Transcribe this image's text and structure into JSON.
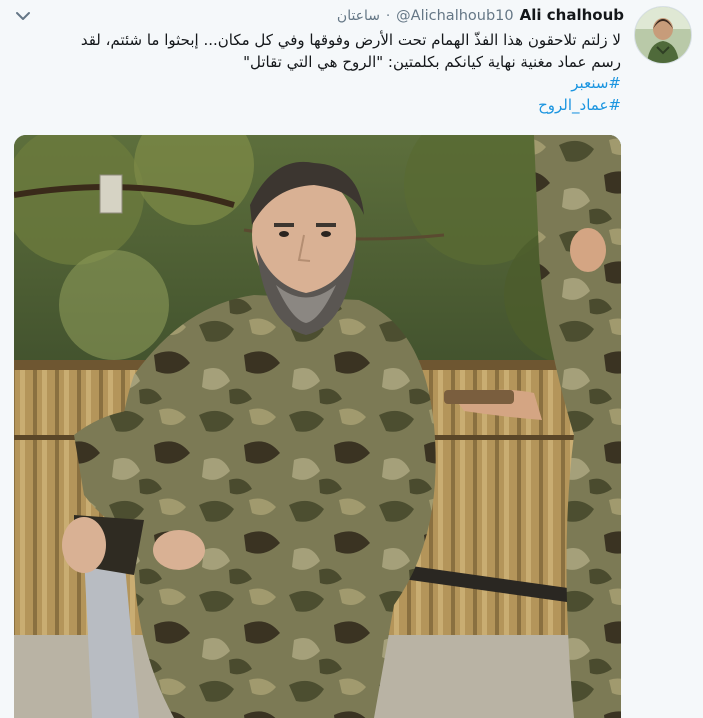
{
  "tweet": {
    "author_name": "Ali chalhoub",
    "handle": "@Alichalhoub10",
    "separator": "·",
    "time": "ساعتان",
    "text_line1": "لا زلتم تلاحقون هذا الفذّ الهمام تحت الأرض وفوقها وفي كل مكان... إبحثوا ما شئتم، لقد",
    "text_line2": "رسم عماد مغنية نهاية كيانكم بكلمتين: \"الروح هي التي تقاتل\"",
    "hashtags": [
      "سنعبر",
      "عماد_الروح"
    ],
    "hash_symbol": "#"
  },
  "icons": {
    "caret": "chevron-down-icon",
    "avatar": "user-avatar"
  },
  "colors": {
    "background": "#f5f8fa",
    "text": "#14171a",
    "secondary": "#657786",
    "link": "#1b95e0"
  }
}
